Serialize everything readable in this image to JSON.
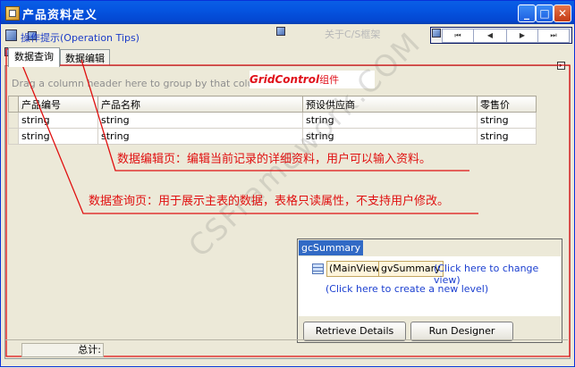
{
  "window": {
    "title": "产品资料定义"
  },
  "toolbar": {
    "operation_tips": "操作提示(Operation Tips)",
    "about_cs": "关于C/S框架",
    "nav_buttons": [
      "⏮",
      "◀",
      "▶",
      "⏭"
    ]
  },
  "tabs": [
    {
      "label": "数据查询"
    },
    {
      "label": "数据编辑"
    }
  ],
  "grid": {
    "group_panel_text": "Drag a column header here to group by that column",
    "control_label_bold": "GridControl",
    "control_label_suffix": "组件",
    "columns": [
      "产品编号",
      "产品名称",
      "预设供应商",
      "零售价"
    ],
    "rows": [
      [
        "string",
        "string",
        "string",
        "string"
      ],
      [
        "string",
        "string",
        "string",
        "string"
      ]
    ]
  },
  "annotations": {
    "edit_page_note": "数据编辑页：编辑当前记录的详细资料，用户可以输入资料。",
    "query_page_note": "数据查询页：用于展示主表的数据，表格只读属性，不支持用户修改。"
  },
  "watermark": "CSFramework.COM",
  "summary": {
    "header": "gcSummary",
    "main_view": "(MainView)",
    "view_name": "gvSummary",
    "change_view_link": "(Click here to change view)",
    "create_level_link": "(Click here to create a new level)",
    "retrieve_button": "Retrieve Details",
    "designer_button": "Run Designer"
  },
  "footer": {
    "total_label": "总计:"
  },
  "colors": {
    "title_bar": "#0554e0",
    "annotation": "#e01010",
    "link": "#1b3fd0"
  }
}
